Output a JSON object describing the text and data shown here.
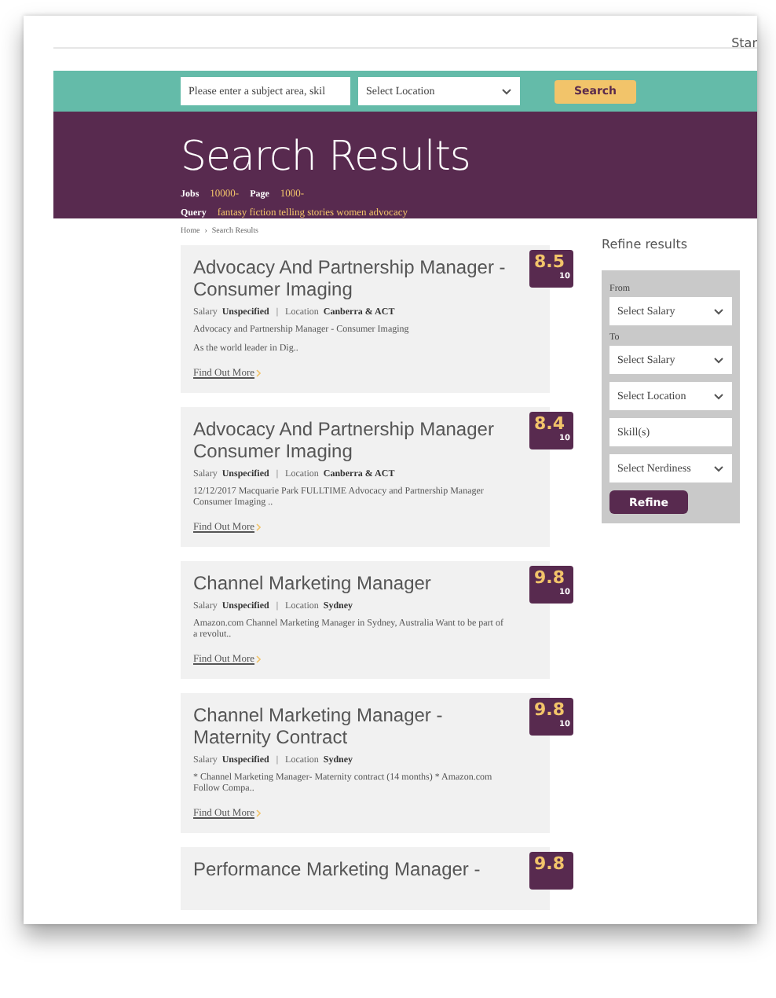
{
  "topbar": {
    "link": "Star"
  },
  "search": {
    "placeholder": "Please enter a subject area, skil",
    "location": "Select Location",
    "button": "Search"
  },
  "header": {
    "title": "Search Results",
    "stats": [
      {
        "label": "Jobs",
        "value": "10000-"
      },
      {
        "label": "Page",
        "value": "1000-"
      }
    ],
    "query_label": "Query",
    "query": "fantasy fiction telling stories women advocacy"
  },
  "breadcrumb": [
    "Home",
    "Search Results"
  ],
  "breadcrumb_separator": "›",
  "meta_separator": "|",
  "results": [
    {
      "title": "Advocacy And Partnership Manager - Consumer Imaging",
      "score": "8.5",
      "out_of": "10",
      "salary_label": "Salary",
      "salary": "Unspecified",
      "location_label": "Location",
      "location": "Canberra & ACT",
      "lines": [
        "Advocacy and Partnership Manager - Consumer Imaging",
        "As the world leader in Dig.."
      ],
      "link": "Find Out More"
    },
    {
      "title": "Advocacy And Partnership Manager Consumer Imaging",
      "score": "8.4",
      "out_of": "10",
      "salary_label": "Salary",
      "salary": "Unspecified",
      "location_label": "Location",
      "location": "Canberra & ACT",
      "lines": [
        "12/12/2017 Macquarie Park FULLTIME Advocacy and Partnership Manager Consumer Imaging .."
      ],
      "link": "Find Out More"
    },
    {
      "title": "Channel Marketing Manager",
      "score": "9.8",
      "out_of": "10",
      "salary_label": "Salary",
      "salary": "Unspecified",
      "location_label": "Location",
      "location": "Sydney",
      "lines": [
        "Amazon.com Channel Marketing Manager in Sydney, Australia Want to be part of a revolut.."
      ],
      "link": "Find Out More"
    },
    {
      "title": "Channel Marketing Manager - Maternity Contract",
      "score": "9.8",
      "out_of": "10",
      "salary_label": "Salary",
      "salary": "Unspecified",
      "location_label": "Location",
      "location": "Sydney",
      "lines": [
        "* Channel Marketing Manager- Maternity contract (14 months) * Amazon.com Follow Compa.."
      ],
      "link": "Find Out More"
    },
    {
      "title": "Performance Marketing Manager -",
      "score": "9.8"
    }
  ],
  "refine": {
    "title": "Refine results",
    "fields": [
      {
        "kind": "select",
        "label": "From",
        "value": "Select Salary"
      },
      {
        "kind": "select",
        "label": "To",
        "value": "Select Salary"
      },
      {
        "kind": "select",
        "value": "Select Location"
      },
      {
        "kind": "input",
        "placeholder": "Skill(s)"
      },
      {
        "kind": "select",
        "value": "Select Nerdiness"
      }
    ],
    "button": "Refine"
  }
}
